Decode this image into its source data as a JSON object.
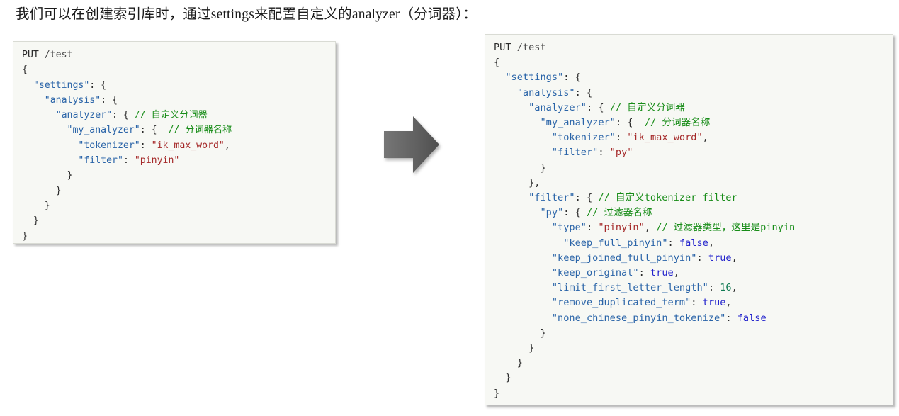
{
  "heading": {
    "text": "我们可以在创建索引库时，通过settings来配置自定义的analyzer（分词器）："
  },
  "arrow": {
    "icon": "right-arrow-icon",
    "fill_start": "#6e6e6e",
    "fill_end": "#555555"
  },
  "colors": {
    "panel_background": "#f7f8f4",
    "panel_border": "#d9dbd4",
    "key": "#2a64a8",
    "string": "#a52a2a",
    "comment": "#178c17",
    "boolean": "#2222cc",
    "number": "#0f7a52",
    "plain": "#2b2b2b"
  },
  "left_panel": {
    "title": "before-config-code-block",
    "lines": [
      [
        {
          "t": "PUT ",
          "c": "kw"
        },
        {
          "t": "/test",
          "c": "path"
        }
      ],
      [
        {
          "t": "{",
          "c": "p"
        }
      ],
      [
        {
          "t": "  ",
          "c": "p"
        },
        {
          "t": "\"settings\"",
          "c": "k"
        },
        {
          "t": ": {",
          "c": "p"
        }
      ],
      [
        {
          "t": "    ",
          "c": "p"
        },
        {
          "t": "\"analysis\"",
          "c": "k"
        },
        {
          "t": ": {",
          "c": "p"
        }
      ],
      [
        {
          "t": "      ",
          "c": "p"
        },
        {
          "t": "\"analyzer\"",
          "c": "k"
        },
        {
          "t": ": { ",
          "c": "p"
        },
        {
          "t": "// 自定义分词器",
          "c": "c"
        }
      ],
      [
        {
          "t": "        ",
          "c": "p"
        },
        {
          "t": "\"my_analyzer\"",
          "c": "k"
        },
        {
          "t": ": {  ",
          "c": "p"
        },
        {
          "t": "// 分词器名称",
          "c": "c"
        }
      ],
      [
        {
          "t": "          ",
          "c": "p"
        },
        {
          "t": "\"tokenizer\"",
          "c": "k"
        },
        {
          "t": ": ",
          "c": "p"
        },
        {
          "t": "\"ik_max_word\"",
          "c": "s"
        },
        {
          "t": ",",
          "c": "p"
        }
      ],
      [
        {
          "t": "          ",
          "c": "p"
        },
        {
          "t": "\"filter\"",
          "c": "k"
        },
        {
          "t": ": ",
          "c": "p"
        },
        {
          "t": "\"pinyin\"",
          "c": "s"
        }
      ],
      [
        {
          "t": "        }",
          "c": "p"
        }
      ],
      [
        {
          "t": "      }",
          "c": "p"
        }
      ],
      [
        {
          "t": "    }",
          "c": "p"
        }
      ],
      [
        {
          "t": "  }",
          "c": "p"
        }
      ],
      [
        {
          "t": "}",
          "c": "p"
        }
      ]
    ]
  },
  "right_panel": {
    "title": "after-config-code-block",
    "lines": [
      [
        {
          "t": "PUT ",
          "c": "kw"
        },
        {
          "t": "/test",
          "c": "path"
        }
      ],
      [
        {
          "t": "{",
          "c": "p"
        }
      ],
      [
        {
          "t": "  ",
          "c": "p"
        },
        {
          "t": "\"settings\"",
          "c": "k"
        },
        {
          "t": ": {",
          "c": "p"
        }
      ],
      [
        {
          "t": "    ",
          "c": "p"
        },
        {
          "t": "\"analysis\"",
          "c": "k"
        },
        {
          "t": ": {",
          "c": "p"
        }
      ],
      [
        {
          "t": "      ",
          "c": "p"
        },
        {
          "t": "\"analyzer\"",
          "c": "k"
        },
        {
          "t": ": { ",
          "c": "p"
        },
        {
          "t": "// 自定义分词器",
          "c": "c"
        }
      ],
      [
        {
          "t": "        ",
          "c": "p"
        },
        {
          "t": "\"my_analyzer\"",
          "c": "k"
        },
        {
          "t": ": {  ",
          "c": "p"
        },
        {
          "t": "// 分词器名称",
          "c": "c"
        }
      ],
      [
        {
          "t": "          ",
          "c": "p"
        },
        {
          "t": "\"tokenizer\"",
          "c": "k"
        },
        {
          "t": ": ",
          "c": "p"
        },
        {
          "t": "\"ik_max_word\"",
          "c": "s"
        },
        {
          "t": ",",
          "c": "p"
        }
      ],
      [
        {
          "t": "          ",
          "c": "p"
        },
        {
          "t": "\"filter\"",
          "c": "k"
        },
        {
          "t": ": ",
          "c": "p"
        },
        {
          "t": "\"py\"",
          "c": "s"
        }
      ],
      [
        {
          "t": "        }",
          "c": "p"
        }
      ],
      [
        {
          "t": "      },",
          "c": "p"
        }
      ],
      [
        {
          "t": "      ",
          "c": "p"
        },
        {
          "t": "\"filter\"",
          "c": "k"
        },
        {
          "t": ": { ",
          "c": "p"
        },
        {
          "t": "// 自定义tokenizer filter",
          "c": "c"
        }
      ],
      [
        {
          "t": "        ",
          "c": "p"
        },
        {
          "t": "\"py\"",
          "c": "k"
        },
        {
          "t": ": { ",
          "c": "p"
        },
        {
          "t": "// 过滤器名称",
          "c": "c"
        }
      ],
      [
        {
          "t": "          ",
          "c": "p"
        },
        {
          "t": "\"type\"",
          "c": "k"
        },
        {
          "t": ": ",
          "c": "p"
        },
        {
          "t": "\"pinyin\"",
          "c": "s"
        },
        {
          "t": ", ",
          "c": "p"
        },
        {
          "t": "// 过滤器类型，这里是pinyin",
          "c": "c"
        }
      ],
      [
        {
          "t": "            ",
          "c": "p"
        },
        {
          "t": "\"keep_full_pinyin\"",
          "c": "k"
        },
        {
          "t": ": ",
          "c": "p"
        },
        {
          "t": "false",
          "c": "b"
        },
        {
          "t": ",",
          "c": "p"
        }
      ],
      [
        {
          "t": "          ",
          "c": "p"
        },
        {
          "t": "\"keep_joined_full_pinyin\"",
          "c": "k"
        },
        {
          "t": ": ",
          "c": "p"
        },
        {
          "t": "true",
          "c": "b"
        },
        {
          "t": ",",
          "c": "p"
        }
      ],
      [
        {
          "t": "          ",
          "c": "p"
        },
        {
          "t": "\"keep_original\"",
          "c": "k"
        },
        {
          "t": ": ",
          "c": "p"
        },
        {
          "t": "true",
          "c": "b"
        },
        {
          "t": ",",
          "c": "p"
        }
      ],
      [
        {
          "t": "          ",
          "c": "p"
        },
        {
          "t": "\"limit_first_letter_length\"",
          "c": "k"
        },
        {
          "t": ": ",
          "c": "p"
        },
        {
          "t": "16",
          "c": "n"
        },
        {
          "t": ",",
          "c": "p"
        }
      ],
      [
        {
          "t": "          ",
          "c": "p"
        },
        {
          "t": "\"remove_duplicated_term\"",
          "c": "k"
        },
        {
          "t": ": ",
          "c": "p"
        },
        {
          "t": "true",
          "c": "b"
        },
        {
          "t": ",",
          "c": "p"
        }
      ],
      [
        {
          "t": "          ",
          "c": "p"
        },
        {
          "t": "\"none_chinese_pinyin_tokenize\"",
          "c": "k"
        },
        {
          "t": ": ",
          "c": "p"
        },
        {
          "t": "false",
          "c": "b"
        }
      ],
      [
        {
          "t": "        }",
          "c": "p"
        }
      ],
      [
        {
          "t": "      }",
          "c": "p"
        }
      ],
      [
        {
          "t": "    }",
          "c": "p"
        }
      ],
      [
        {
          "t": "  }",
          "c": "p"
        }
      ],
      [
        {
          "t": "}",
          "c": "p"
        }
      ]
    ]
  }
}
